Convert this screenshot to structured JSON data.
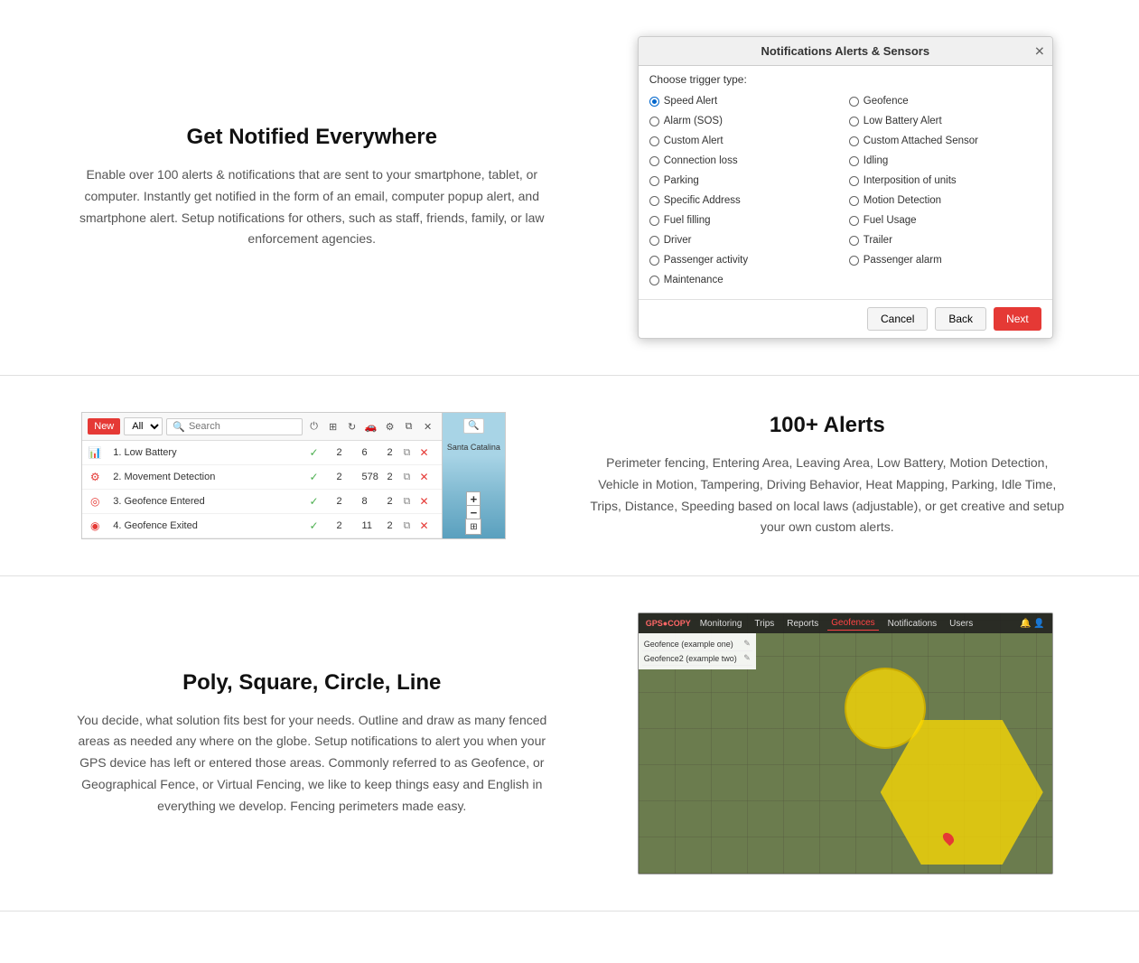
{
  "sections": [
    {
      "id": "notifications",
      "layout": "text-left",
      "heading": "Get Notified Everywhere",
      "body": "Enable over 100 alerts & notifications that are sent to your smartphone, tablet, or computer. Instantly get notified in the form of an email, computer popup alert, and smartphone alert. Setup notifications for others, such as staff, friends, family, or law enforcement agencies."
    },
    {
      "id": "alerts",
      "layout": "text-right",
      "heading": "100+ Alerts",
      "body": "Perimeter fencing, Entering Area, Leaving Area, Low Battery, Motion Detection, Vehicle in Motion, Tampering, Driving Behavior, Heat Mapping, Parking, Idle Time, Trips, Distance, Speeding based on local laws (adjustable), or get creative and setup your own custom alerts."
    },
    {
      "id": "geofence",
      "layout": "text-left",
      "heading": "Poly, Square, Circle, Line",
      "body": "You decide, what solution fits best for your needs. Outline and draw as many fenced areas as needed any where on the globe. Setup notifications to alert you when your GPS device has left or entered those areas. Commonly referred to as Geofence, or Geographical Fence, or Virtual Fencing, we like to keep things easy and English in everything we develop. Fencing perimeters made easy."
    }
  ],
  "dialog": {
    "title": "Notifications Alerts & Sensors",
    "subtitle": "Choose trigger type:",
    "options_col1": [
      {
        "label": "Speed Alert",
        "selected": true
      },
      {
        "label": "Alarm (SOS)",
        "selected": false
      },
      {
        "label": "Custom Alert",
        "selected": false
      },
      {
        "label": "Connection loss",
        "selected": false
      },
      {
        "label": "Parking",
        "selected": false
      },
      {
        "label": "Specific Address",
        "selected": false
      },
      {
        "label": "Fuel filling",
        "selected": false
      },
      {
        "label": "Driver",
        "selected": false
      },
      {
        "label": "Passenger activity",
        "selected": false
      },
      {
        "label": "Maintenance",
        "selected": false
      }
    ],
    "options_col2": [
      {
        "label": "Geofence",
        "selected": false
      },
      {
        "label": "Low Battery Alert",
        "selected": false
      },
      {
        "label": "Custom Attached Sensor",
        "selected": false
      },
      {
        "label": "Idling",
        "selected": false
      },
      {
        "label": "Interposition of units",
        "selected": false
      },
      {
        "label": "Motion Detection",
        "selected": false
      },
      {
        "label": "Fuel Usage",
        "selected": false
      },
      {
        "label": "Trailer",
        "selected": false
      },
      {
        "label": "Passenger alarm",
        "selected": false
      }
    ],
    "buttons": {
      "cancel": "Cancel",
      "back": "Back",
      "next": "Next"
    }
  },
  "alerts_list": {
    "new_btn": "New",
    "filter_all": "All",
    "search_placeholder": "Search",
    "rows": [
      {
        "icon": "battery",
        "name": "1. Low Battery",
        "check": true,
        "count1": "2",
        "count2": "6",
        "count3": "2"
      },
      {
        "icon": "movement",
        "name": "2. Movement Detection",
        "check": true,
        "count1": "2",
        "count2": "578",
        "count3": "2"
      },
      {
        "icon": "geofence-enter",
        "name": "3. Geofence Entered",
        "check": true,
        "count1": "2",
        "count2": "8",
        "count3": "2"
      },
      {
        "icon": "geofence-exit",
        "name": "4. Geofence Exited",
        "check": true,
        "count1": "2",
        "count2": "11",
        "count3": "2"
      }
    ],
    "map_location": "Santa Catalina"
  },
  "geofence": {
    "toolbar_items": [
      "Monitoring",
      "Trips",
      "Reports",
      "Geofences",
      "Notifications",
      "Users"
    ],
    "active_item": "Geofences",
    "panel_rows": [
      {
        "label": "Geofence (example one)",
        "value": ""
      },
      {
        "label": "Geofence2 (example two)",
        "value": ""
      }
    ]
  }
}
